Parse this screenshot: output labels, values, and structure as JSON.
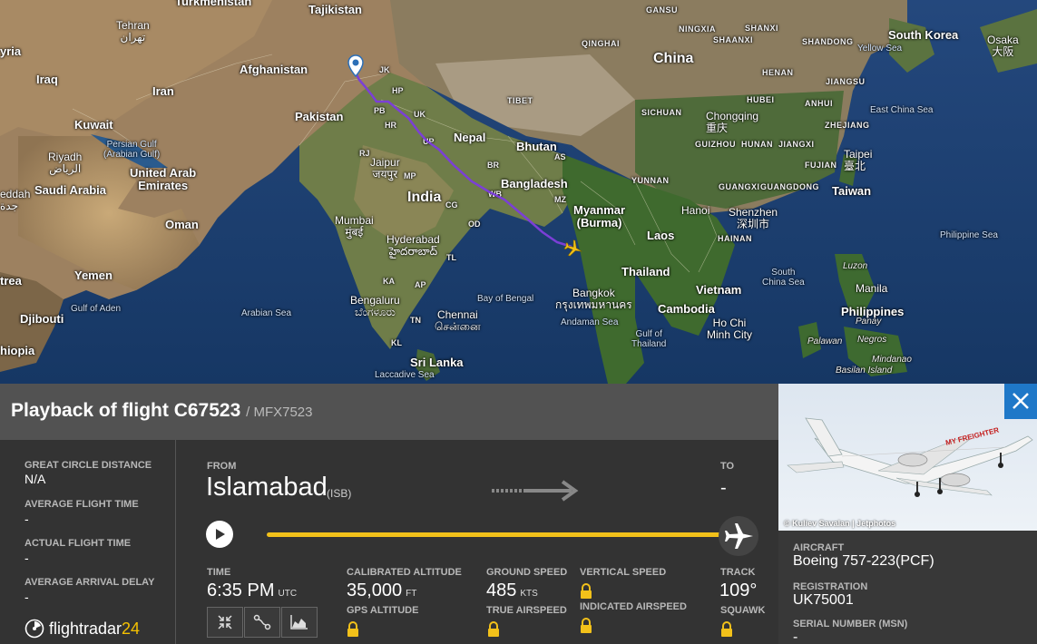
{
  "map": {
    "countries": {
      "turkmenistan": "Turkmenistan",
      "tajikistan": "Tajikistan",
      "afghanistan": "Afghanistan",
      "iran": "Iran",
      "iraq": "Iraq",
      "syria": "yria",
      "kuwait": "Kuwait",
      "pakistan": "Pakistan",
      "saudi": "Saudi Arabia",
      "uae": "United Arab\nEmirates",
      "oman": "Oman",
      "yemen": "Yemen",
      "india": "India",
      "nepal": "Nepal",
      "bhutan": "Bhutan",
      "bangladesh": "Bangladesh",
      "myanmar": "Myanmar\n(Burma)",
      "laos": "Laos",
      "thailand": "Thailand",
      "vietnam": "Vietnam",
      "cambodia": "Cambodia",
      "china": "China",
      "south_korea": "South Korea",
      "taiwan": "Taiwan",
      "philippines": "Philippines",
      "sri_lanka": "Sri Lanka",
      "djibouti": "Djibouti",
      "eritrea": "trea",
      "ethiopia": "hiopia"
    },
    "cities": {
      "tehran": "Tehran\nتهران",
      "riyadh": "Riyadh\nالرياض",
      "jeddah": "eddah\nجدة",
      "mumbai": "Mumbai\nमुंबई",
      "jaipur": "Jaipur\nजयपुर",
      "hyderabad": "Hyderabad\nహైదరాబాద్",
      "bengaluru": "Bengaluru\nಬೆಂಗಳೂರು",
      "chennai": "Chennai\nசென்னை",
      "bangkok": "Bangkok\nกรุงเทพมหานคร",
      "hanoi": "Hanoi",
      "hochiminh": "Ho Chi\nMinh City",
      "shenzhen": "Shenzhen\n深圳市",
      "chongqing": "Chongqing\n重庆",
      "taipei": "Taipei\n臺北",
      "manila": "Manila",
      "osaka": "Osaka\n大阪"
    },
    "seas": {
      "persian_gulf": "Persian Gulf\n(Arabian Gulf)",
      "arabian_sea": "Arabian Sea",
      "gulf_aden": "Gulf of Aden",
      "bay_bengal": "Bay of Bengal",
      "andaman": "Andaman Sea",
      "gulf_thailand": "Gulf of\nThailand",
      "south_china": "South\nChina Sea",
      "philippine": "Philippine Sea",
      "east_china": "East China Sea",
      "yellow": "Yellow Sea",
      "laccadive": "Laccadive Sea"
    },
    "regions": {
      "gansu": "GANSU",
      "ningxia": "NINGXIA",
      "shanxi": "SHANXI",
      "shaanxi": "SHAANXI",
      "shandong": "SHANDONG",
      "qinghai": "QINGHAI",
      "henan": "HENAN",
      "jiangsu": "JIANGSU",
      "tibet": "TIBET",
      "hubei": "HUBEI",
      "anhui": "ANHUI",
      "zhejiang": "ZHEJIANG",
      "sichuan": "SICHUAN",
      "guizhou": "GUIZHOU",
      "hunan": "HUNAN",
      "jiangxi": "JIANGXI",
      "fujian": "FUJIAN",
      "yunnan": "YUNNAN",
      "guangxi": "GUANGXI",
      "guangdong": "GUANGDONG",
      "hainan": "HAINAN",
      "luzon": "Luzon",
      "palawan": "Palawan",
      "negros": "Negros",
      "panay": "Panay",
      "mindanao": "Mindanao",
      "basilan": "Basilan Island"
    },
    "abbrs": [
      "JK",
      "HP",
      "PB",
      "UK",
      "HR",
      "UP",
      "RJ",
      "BR",
      "AS",
      "WB",
      "MZ",
      "MP",
      "OD",
      "CG",
      "AP",
      "KA",
      "TN",
      "KL",
      "TL"
    ]
  },
  "flight": {
    "title": "Playback of flight C67523",
    "callsign": "/ MFX7523"
  },
  "stats": {
    "gcd_label": "GREAT CIRCLE DISTANCE",
    "gcd_value": "N/A",
    "avg_time_label": "AVERAGE FLIGHT TIME",
    "avg_time_value": "-",
    "actual_time_label": "ACTUAL FLIGHT TIME",
    "actual_time_value": "-",
    "delay_label": "AVERAGE ARRIVAL DELAY",
    "delay_value": "-"
  },
  "route": {
    "from_label": "FROM",
    "from_city": "Islamabad",
    "from_code": "(ISB)",
    "to_label": "TO",
    "to_value": "-"
  },
  "playback": {
    "progress_fraction": 0.97
  },
  "telemetry": {
    "time_label": "TIME",
    "time_value": "6:35 PM",
    "time_unit": "UTC",
    "alt_label": "CALIBRATED ALTITUDE",
    "alt_value": "35,000",
    "alt_unit": "FT",
    "gps_alt_label": "GPS ALTITUDE",
    "gs_label": "GROUND SPEED",
    "gs_value": "485",
    "gs_unit": "KTS",
    "tas_label": "TRUE AIRSPEED",
    "vs_label": "VERTICAL SPEED",
    "ias_label": "INDICATED AIRSPEED",
    "track_label": "TRACK",
    "track_value": "109°",
    "squawk_label": "SQUAWK"
  },
  "aircraft": {
    "photo_credit": "© Kuliev Savalan | Jetphotos",
    "livery_text": "MY FREIGHTER",
    "aircraft_label": "AIRCRAFT",
    "aircraft_value": "Boeing 757-223(PCF)",
    "reg_label": "REGISTRATION",
    "reg_value": "UK75001",
    "serial_label": "SERIAL NUMBER (MSN)",
    "serial_value": "-"
  },
  "brand": {
    "name": "flightradar",
    "num": "24"
  },
  "colors": {
    "accent": "#f2c11a",
    "close_blue": "#1f78c8",
    "route_purple": "#7b3fd6"
  }
}
